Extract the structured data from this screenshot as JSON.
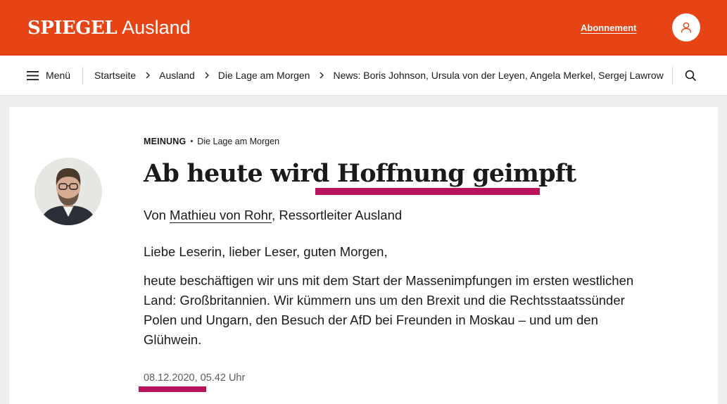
{
  "header": {
    "logo": "SPIEGEL",
    "section": "Ausland",
    "subscription_label": "Abonnement",
    "account_icon": "user-icon",
    "background_color": "#e64415"
  },
  "nav": {
    "menu_label": "Menü",
    "menu_icon": "hamburger-icon",
    "breadcrumbs": [
      "Startseite",
      "Ausland",
      "Die Lage am Morgen",
      "News: Boris Johnson, Ursula von der Leyen, Angela Merkel, Sergej Lawrow"
    ],
    "search_icon": "search-icon"
  },
  "article": {
    "kicker": "MEINUNG",
    "kicker_sub": "Die Lage am Morgen",
    "headline_start": "Ab heute wird ",
    "headline_highlight": "Hoffnung geimpft",
    "byline_prefix": "Von ",
    "author": "Mathieu von Rohr",
    "author_role": ", Ressortleiter Ausland",
    "greeting": "Liebe Leserin, lieber Leser, guten Morgen,",
    "body": "heute beschäftigen wir uns mit dem Start der Massenimpfungen im ersten westlichen Land: Großbritannien. Wir kümmern uns um den Brexit und die Rechtsstaatssünder Polen und Ungarn, den Besuch der AfD bei Freunden in Moskau – und um den Glühwein.",
    "date": "08.12.2020",
    "time": ", 05.42 Uhr",
    "highlight_color": "#b5135c"
  }
}
